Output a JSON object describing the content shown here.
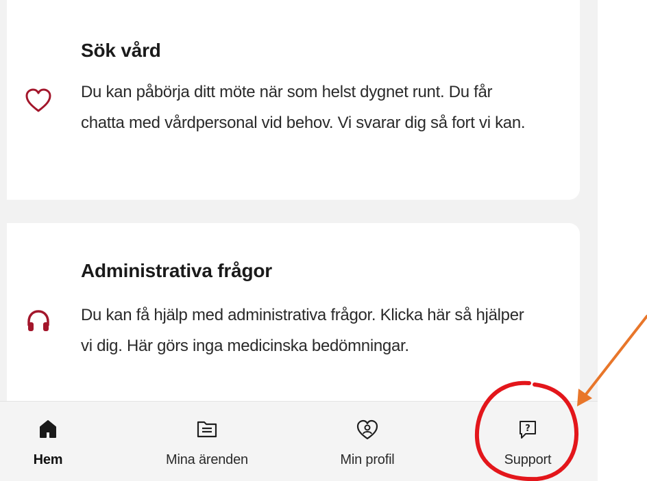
{
  "cards": [
    {
      "title": "Sök vård",
      "text": "Du kan påbörja ditt möte när som helst dygnet runt. Du får chatta med vårdpersonal vid behov. Vi svarar dig så fort vi kan.",
      "icon": "heart-icon"
    },
    {
      "title": "Administrativa frågor",
      "text": "Du kan få hjälp med administrativa frågor. Klicka här så hjälper vi dig. Här görs inga medicinska bedömningar.",
      "icon": "headset-icon"
    }
  ],
  "bottom_nav": {
    "items": [
      {
        "label": "Hem",
        "icon": "home-icon",
        "active": true
      },
      {
        "label": "Mina ärenden",
        "icon": "document-icon",
        "active": false
      },
      {
        "label": "Min profil",
        "icon": "profile-heart-icon",
        "active": false
      },
      {
        "label": "Support",
        "icon": "question-bubble-icon",
        "active": false
      }
    ]
  },
  "colors": {
    "accent": "#a3162b",
    "annotation_circle": "#e3161b",
    "annotation_arrow": "#e8762a"
  }
}
